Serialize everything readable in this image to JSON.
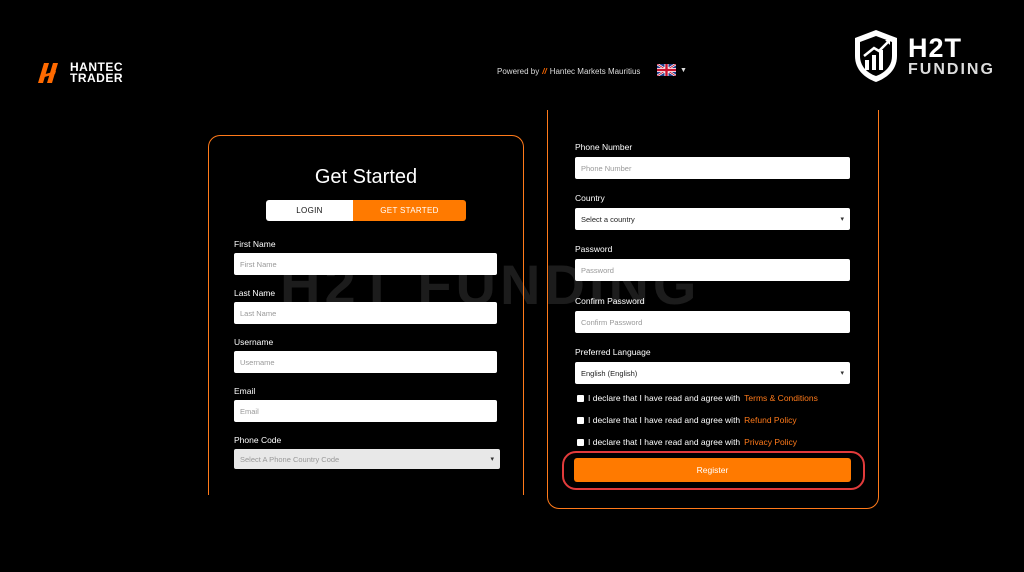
{
  "header": {
    "brand": {
      "line1": "HANTEC",
      "line2": "TRADER"
    },
    "powered_prefix": "Powered by",
    "powered_company": "Hantec Markets Mauritius",
    "language_icon": "uk-flag-icon"
  },
  "watermark_logo": {
    "top": "H2T",
    "bottom": "FUNDING"
  },
  "watermark_text": "H2T FUNDING",
  "colors": {
    "accent": "#ff7a00",
    "highlight_ring": "#e23b3b",
    "background": "#000000"
  },
  "form": {
    "title": "Get Started",
    "tabs": {
      "login": "LOGIN",
      "get_started": "GET STARTED"
    },
    "first_name": {
      "label": "First Name",
      "placeholder": "First Name"
    },
    "last_name": {
      "label": "Last Name",
      "placeholder": "Last Name"
    },
    "username": {
      "label": "Username",
      "placeholder": "Username"
    },
    "email": {
      "label": "Email",
      "placeholder": "Email"
    },
    "phone_code": {
      "label": "Phone Code",
      "placeholder": "Select A Phone Country Code"
    },
    "phone_number": {
      "label": "Phone Number",
      "placeholder": "Phone Number"
    },
    "country": {
      "label": "Country",
      "value": "Select a country"
    },
    "password": {
      "label": "Password",
      "placeholder": "Password"
    },
    "confirm_password": {
      "label": "Confirm Password",
      "placeholder": "Confirm Password"
    },
    "preferred_language": {
      "label": "Preferred Language",
      "value": "English (English)"
    },
    "declare_text": "I declare that I have read and agree with",
    "terms_link": "Terms & Conditions",
    "refund_link": "Refund Policy",
    "privacy_link": "Privacy Policy",
    "register_label": "Register"
  }
}
